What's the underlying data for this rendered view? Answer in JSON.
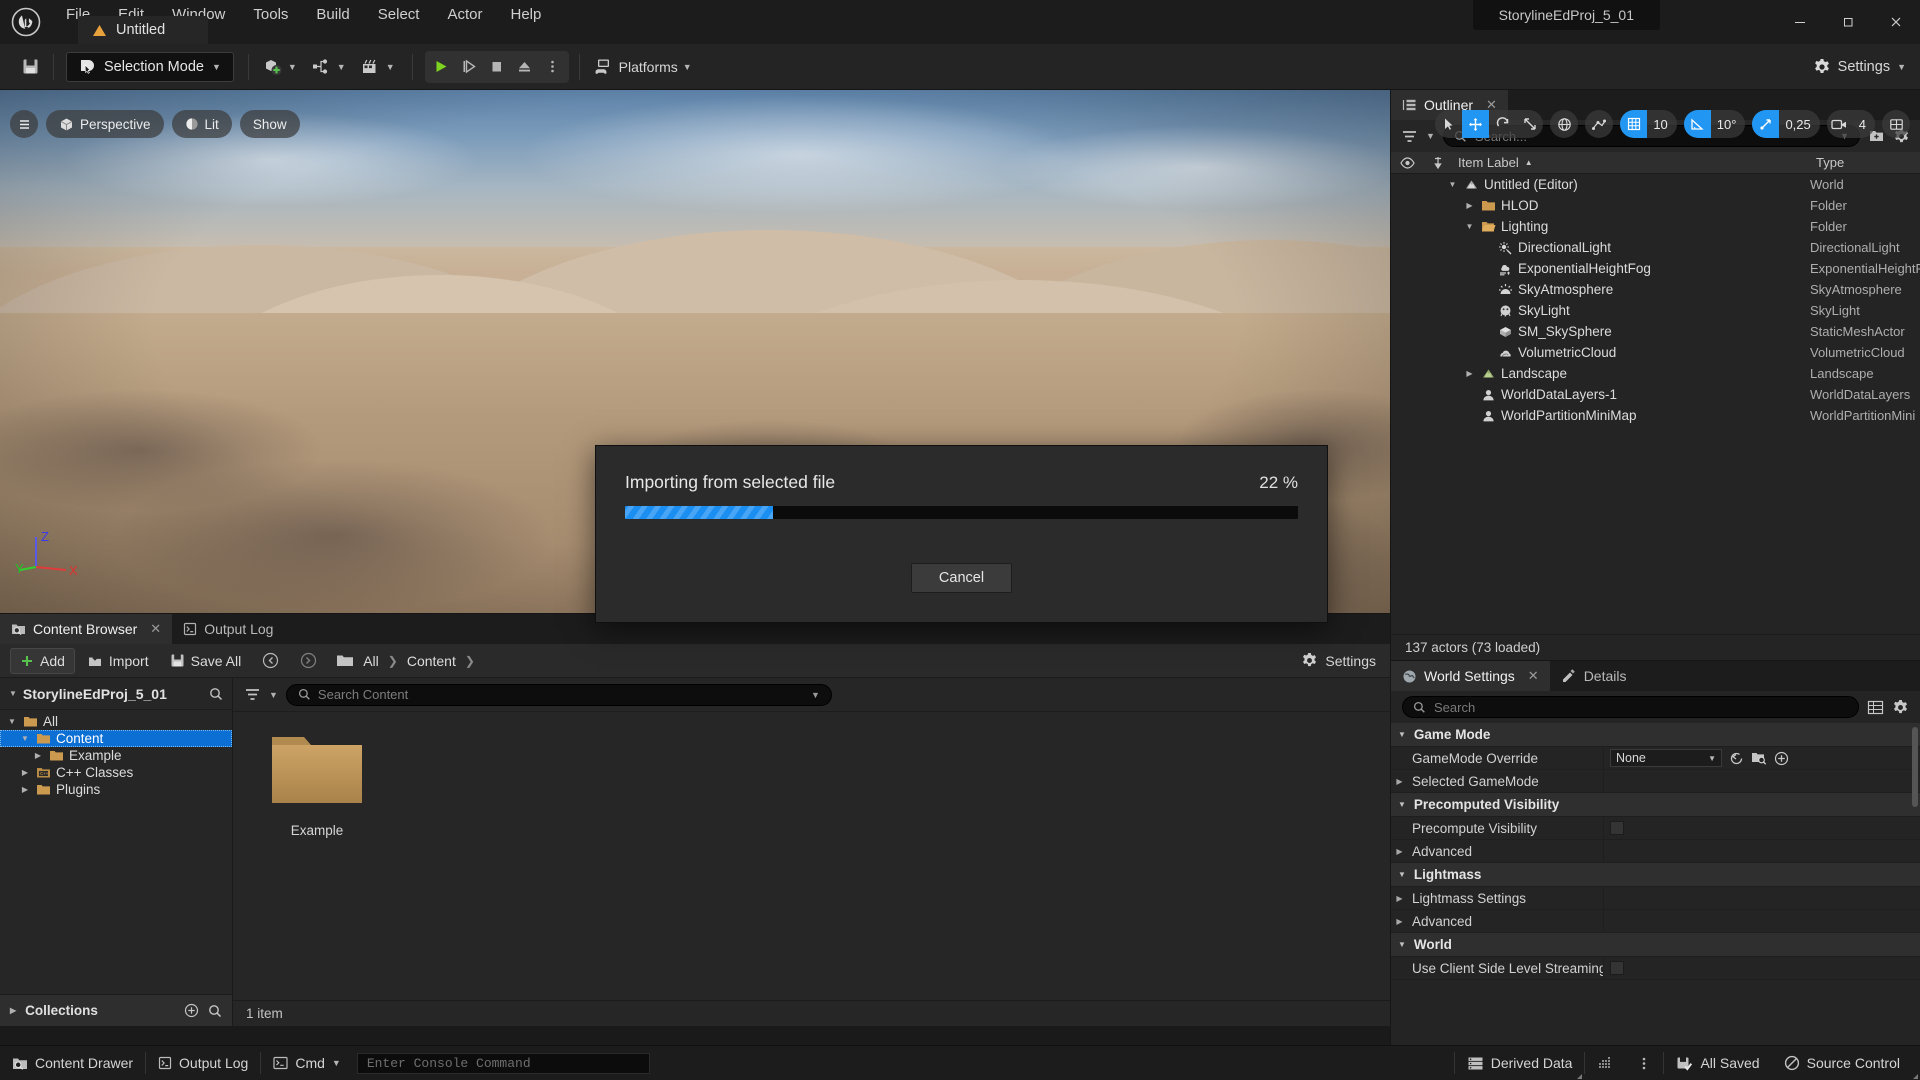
{
  "titlebar": {
    "menus": [
      "File",
      "Edit",
      "Window",
      "Tools",
      "Build",
      "Select",
      "Actor",
      "Help"
    ],
    "project_tab": "Untitled",
    "window_title": "StorylineEdProj_5_01",
    "minimize": "—",
    "maximize": "❐",
    "close": "✕"
  },
  "toolbar": {
    "save_icon": "save-icon",
    "selection_mode": "Selection Mode",
    "add_icon": "add-actor-icon",
    "blueprint_icon": "blueprints-icon",
    "cinematics_icon": "cinematics-icon",
    "play": "play-icon",
    "skip": "skip-icon",
    "stop": "stop-icon",
    "eject": "eject-icon",
    "more": "more-options-icon",
    "platforms": "Platforms",
    "settings": "Settings"
  },
  "viewport": {
    "menu_icon": "viewport-menu-icon",
    "perspective": "Perspective",
    "lit": "Lit",
    "show": "Show",
    "transform_tools": [
      "select-icon",
      "move-icon",
      "rotate-icon",
      "scale-icon"
    ],
    "coord_icon": "world-coordinate-icon",
    "snap_icon": "surface-snap-icon",
    "grid_snap_value": "10",
    "angle_snap_value": "10°",
    "scale_snap_value": "0,25",
    "camera_speed_value": "4",
    "layout_icon": "viewport-layout-icon",
    "axis": {
      "x": "X",
      "y": "Y",
      "z": "Z"
    }
  },
  "modal": {
    "title": "Importing from selected file",
    "percent_label": "22 %",
    "percent": 22,
    "cancel": "Cancel",
    "accent_color": "#1b8ef2"
  },
  "content_browser": {
    "tabs": [
      {
        "label": "Content Browser",
        "icon": "content-browser-icon",
        "active": true,
        "closable": true
      },
      {
        "label": "Output Log",
        "icon": "output-log-icon",
        "active": false,
        "closable": false
      }
    ],
    "toolbar": {
      "add": "Add",
      "import": "Import",
      "save_all": "Save All",
      "back_icon": "back-arrow-icon",
      "forward_icon": "forward-arrow-icon",
      "folder_icon": "folder-icon",
      "breadcrumb": [
        "All",
        "Content"
      ],
      "settings": "Settings"
    },
    "tree_header": "StorylineEdProj_5_01",
    "tree": [
      {
        "label": "All",
        "depth": 0,
        "expanded": true,
        "selected": false,
        "icon": "folder-icon"
      },
      {
        "label": "Content",
        "depth": 1,
        "expanded": true,
        "selected": true,
        "icon": "folder-icon"
      },
      {
        "label": "Example",
        "depth": 2,
        "expanded": false,
        "selected": false,
        "icon": "folder-icon"
      },
      {
        "label": "C++ Classes",
        "depth": 1,
        "expanded": false,
        "selected": false,
        "icon": "cpp-folder-icon"
      },
      {
        "label": "Plugins",
        "depth": 1,
        "expanded": false,
        "selected": false,
        "icon": "folder-icon"
      }
    ],
    "collections": "Collections",
    "search_placeholder": "Search Content",
    "assets": [
      {
        "name": "Example",
        "type": "folder"
      }
    ],
    "status": "1 item"
  },
  "outliner": {
    "tab_label": "Outliner",
    "tab_icon": "outliner-icon",
    "search_placeholder": "Search...",
    "columns": {
      "item_label": "Item Label",
      "type": "Type",
      "sort_arrow": "▲"
    },
    "rows": [
      {
        "label": "Untitled (Editor)",
        "type": "World",
        "depth": 0,
        "expanded": true,
        "icon": "world-icon"
      },
      {
        "label": "HLOD",
        "type": "Folder",
        "depth": 1,
        "expanded": false,
        "icon": "folder-icon"
      },
      {
        "label": "Lighting",
        "type": "Folder",
        "depth": 1,
        "expanded": true,
        "icon": "folder-open-icon"
      },
      {
        "label": "DirectionalLight",
        "type": "DirectionalLight",
        "depth": 2,
        "icon": "directional-light-icon"
      },
      {
        "label": "ExponentialHeightFog",
        "type": "ExponentialHeightF",
        "depth": 2,
        "icon": "fog-icon"
      },
      {
        "label": "SkyAtmosphere",
        "type": "SkyAtmosphere",
        "depth": 2,
        "icon": "sky-atmosphere-icon"
      },
      {
        "label": "SkyLight",
        "type": "SkyLight",
        "depth": 2,
        "icon": "sky-light-icon"
      },
      {
        "label": "SM_SkySphere",
        "type": "StaticMeshActor",
        "depth": 2,
        "icon": "static-mesh-icon"
      },
      {
        "label": "VolumetricCloud",
        "type": "VolumetricCloud",
        "depth": 2,
        "icon": "volumetric-cloud-icon"
      },
      {
        "label": "Landscape",
        "type": "Landscape",
        "depth": 1,
        "expanded": false,
        "icon": "landscape-icon"
      },
      {
        "label": "WorldDataLayers-1",
        "type": "WorldDataLayers",
        "depth": 1,
        "icon": "actor-icon"
      },
      {
        "label": "WorldPartitionMiniMap",
        "type": "WorldPartitionMini",
        "depth": 1,
        "icon": "actor-icon"
      }
    ],
    "actor_count": "137 actors (73 loaded)"
  },
  "world_settings": {
    "tabs": [
      {
        "label": "World Settings",
        "icon": "globe-icon",
        "active": true,
        "closable": true
      },
      {
        "label": "Details",
        "icon": "details-icon",
        "active": false,
        "closable": false
      }
    ],
    "search_placeholder": "Search",
    "sections": [
      {
        "kind": "category",
        "label": "Game Mode",
        "expanded": true
      },
      {
        "kind": "prop",
        "label": "GameMode Override",
        "value": "None",
        "control": "combo",
        "arrow": false
      },
      {
        "kind": "prop",
        "label": "Selected GameMode",
        "control": "none",
        "arrow": true
      },
      {
        "kind": "category",
        "label": "Precomputed Visibility",
        "expanded": true
      },
      {
        "kind": "prop",
        "label": "Precompute Visibility",
        "control": "checkbox",
        "arrow": false
      },
      {
        "kind": "prop",
        "label": "Advanced",
        "control": "none",
        "arrow": true
      },
      {
        "kind": "category",
        "label": "Lightmass",
        "expanded": true
      },
      {
        "kind": "prop",
        "label": "Lightmass Settings",
        "control": "none",
        "arrow": true
      },
      {
        "kind": "prop",
        "label": "Advanced",
        "control": "none",
        "arrow": true
      },
      {
        "kind": "category",
        "label": "World",
        "expanded": true
      },
      {
        "kind": "prop",
        "label": "Use Client Side Level Streaming Volumes",
        "control": "checkbox",
        "arrow": false
      }
    ]
  },
  "statusbar": {
    "content_drawer": "Content Drawer",
    "output_log": "Output Log",
    "cmd": "Cmd",
    "console_placeholder": "Enter Console Command",
    "derived_data": "Derived Data",
    "all_saved": "All Saved",
    "source_control": "Source Control"
  }
}
